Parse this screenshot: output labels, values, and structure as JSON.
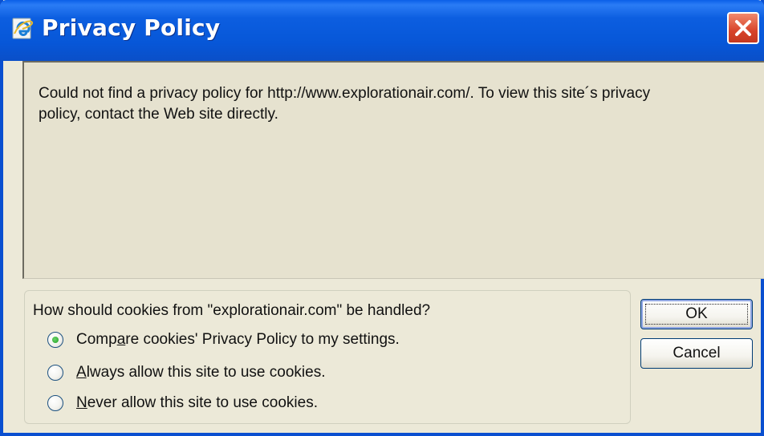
{
  "window": {
    "title": "Privacy Policy",
    "title_icon": "ie-logo-icon",
    "close_icon": "close-icon"
  },
  "policy": {
    "message_line1": "Could not find a privacy policy for http://www.explorationair.com/. To view this site´s privacy",
    "message_line2": "policy, contact the Web site directly."
  },
  "cookies": {
    "question": "How should cookies from \"explorationair.com\" be handled?",
    "options": [
      {
        "pre": "Comp",
        "accel": "a",
        "post": "re cookies' Privacy Policy to my settings.",
        "selected": true
      },
      {
        "pre": "",
        "accel": "A",
        "post": "lways allow this site to use cookies.",
        "selected": false
      },
      {
        "pre": "",
        "accel": "N",
        "post": "ever allow this site to use cookies.",
        "selected": false
      }
    ]
  },
  "buttons": {
    "ok": "OK",
    "cancel": "Cancel"
  },
  "colors": {
    "titlebar": "#0757d8",
    "close": "#d8432a",
    "face": "#ece9d8",
    "radio_dot": "#21a121"
  }
}
